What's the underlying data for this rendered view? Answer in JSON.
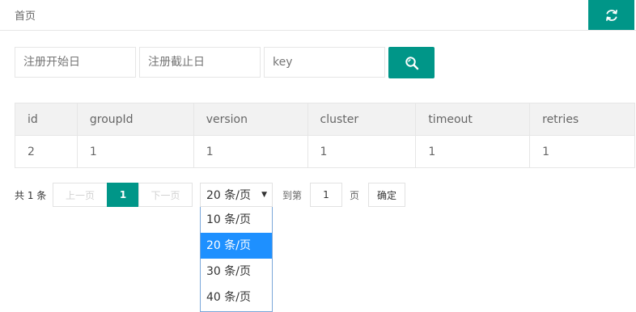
{
  "header": {
    "breadcrumb": "首页",
    "refresh_icon": "refresh-icon",
    "accent": "#009688"
  },
  "filters": {
    "start_placeholder": "注册开始日",
    "end_placeholder": "注册截止日",
    "key_placeholder": "key",
    "search_icon": "search-icon"
  },
  "table": {
    "columns": [
      "id",
      "groupId",
      "version",
      "cluster",
      "timeout",
      "retries"
    ],
    "rows": [
      [
        "2",
        "1",
        "1",
        "1",
        "1",
        "1"
      ]
    ]
  },
  "pagination": {
    "total": "共 1 条",
    "prev": "上一页",
    "current": "1",
    "next": "下一页",
    "page_size": "20 条/页",
    "options": [
      "10 条/页",
      "20 条/页",
      "30 条/页",
      "40 条/页"
    ],
    "goto_label": "到第",
    "goto_value": "1",
    "page_unit": "页",
    "confirm": "确定"
  }
}
